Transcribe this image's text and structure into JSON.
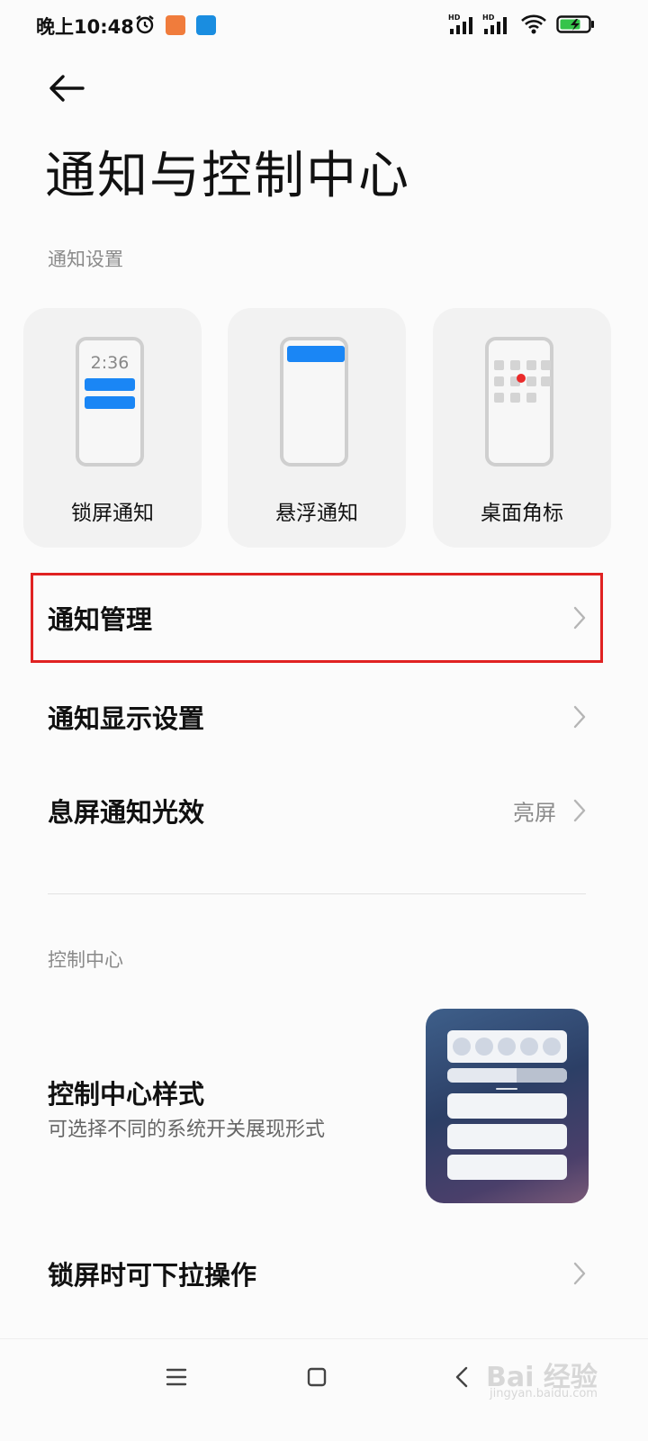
{
  "status_bar": {
    "time": "晚上10:48",
    "hd1": "HD",
    "hd2": "HD"
  },
  "header": {
    "title": "通知与控制中心"
  },
  "notification_section": {
    "label": "通知设置",
    "cards": [
      {
        "label": "锁屏通知",
        "preview_time": "2:36"
      },
      {
        "label": "悬浮通知"
      },
      {
        "label": "桌面角标"
      }
    ]
  },
  "rows": [
    {
      "title": "通知管理",
      "highlighted": true
    },
    {
      "title": "通知显示设置"
    },
    {
      "title": "息屏通知光效",
      "value": "亮屏"
    }
  ],
  "control_section": {
    "label": "控制中心",
    "style_title": "控制中心样式",
    "style_subtitle": "可选择不同的系统开关展现形式",
    "pulldown_title": "锁屏时可下拉操作"
  },
  "watermark": {
    "text": "Bai 经验",
    "sub": "jingyan.baidu.com"
  },
  "colors": {
    "accent_blue": "#1a86f5",
    "highlight_red": "#e02222",
    "badge_red": "#ea2a2a"
  },
  "icons": [
    "alarm-icon",
    "signal-icon",
    "wifi-icon",
    "battery-charging-icon",
    "back-arrow-icon",
    "chevron-right-icon",
    "menu-icon",
    "home-icon",
    "back-nav-icon"
  ]
}
